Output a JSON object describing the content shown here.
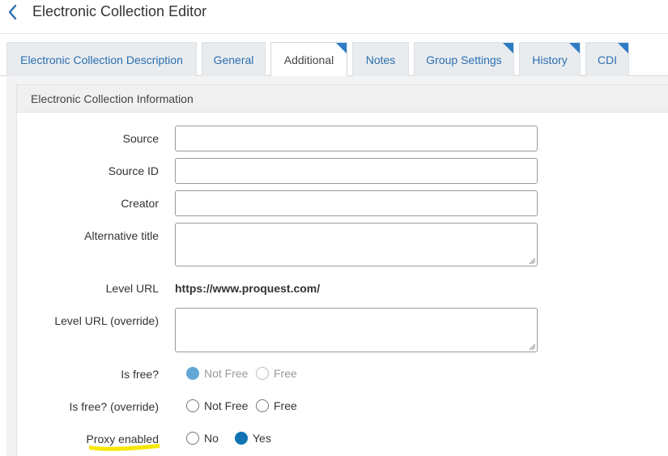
{
  "header": {
    "title": "Electronic Collection Editor",
    "back_icon": "chevron-left-icon"
  },
  "tabs": [
    {
      "label": "Electronic Collection Description",
      "active": false,
      "marked": false
    },
    {
      "label": "General",
      "active": false,
      "marked": false
    },
    {
      "label": "Additional",
      "active": true,
      "marked": true
    },
    {
      "label": "Notes",
      "active": false,
      "marked": false
    },
    {
      "label": "Group Settings",
      "active": false,
      "marked": true
    },
    {
      "label": "History",
      "active": false,
      "marked": true
    },
    {
      "label": "CDI",
      "active": false,
      "marked": true
    }
  ],
  "section": {
    "title": "Electronic Collection Information"
  },
  "form": {
    "source": {
      "label": "Source",
      "value": ""
    },
    "source_id": {
      "label": "Source ID",
      "value": ""
    },
    "creator": {
      "label": "Creator",
      "value": ""
    },
    "alternative_title": {
      "label": "Alternative title",
      "value": ""
    },
    "level_url": {
      "label": "Level URL",
      "value": "https://www.proquest.com/"
    },
    "level_url_override": {
      "label": "Level URL (override)",
      "value": ""
    },
    "is_free": {
      "label": "Is free?",
      "options": [
        "Not Free",
        "Free"
      ],
      "selected": "Not Free",
      "disabled": true
    },
    "is_free_override": {
      "label": "Is free? (override)",
      "options": [
        "Not Free",
        "Free"
      ],
      "selected": null
    },
    "proxy_enabled": {
      "label": "Proxy enabled",
      "options": [
        "No",
        "Yes"
      ],
      "selected": "Yes",
      "highlighted": true
    }
  },
  "colors": {
    "accent": "#0f73b2",
    "tab_link": "#2a6fb0",
    "tab_corner": "#2d7cc4",
    "highlight": "#f7e600"
  }
}
